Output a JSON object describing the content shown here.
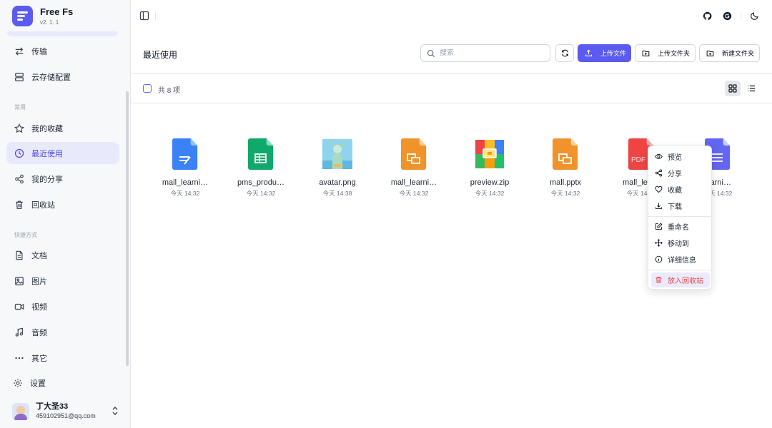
{
  "brand": {
    "name": "Free Fs",
    "version": "v2. 1. 1"
  },
  "sidebar": {
    "top_items": [
      {
        "label": "传输",
        "icon": "transfer-icon"
      },
      {
        "label": "云存储配置",
        "icon": "storage-icon"
      }
    ],
    "common_label": "常用",
    "common_items": [
      {
        "label": "我的收藏",
        "icon": "star-icon"
      },
      {
        "label": "最近使用",
        "icon": "clock-icon",
        "active": true
      },
      {
        "label": "我的分享",
        "icon": "share-icon"
      },
      {
        "label": "回收站",
        "icon": "trash-icon"
      }
    ],
    "shortcut_label": "快捷方式",
    "shortcut_items": [
      {
        "label": "文档",
        "icon": "document-icon"
      },
      {
        "label": "图片",
        "icon": "image-icon"
      },
      {
        "label": "视频",
        "icon": "video-icon"
      },
      {
        "label": "音频",
        "icon": "music-icon"
      },
      {
        "label": "其它",
        "icon": "more-icon"
      }
    ],
    "settings_label": "设置",
    "user": {
      "name": "丁大圣33",
      "email": "459102951@qq.com"
    }
  },
  "header": {
    "title": "最近使用",
    "search_placeholder": "搜索",
    "upload_file": "上传文件",
    "upload_folder": "上传文件夹",
    "new_folder": "新建文件夹"
  },
  "toolbar": {
    "count": "共 8 项"
  },
  "files": [
    {
      "name": "mall_learni…",
      "time": "今天 14:32",
      "type": "doc"
    },
    {
      "name": "pms_produ…",
      "time": "今天 14:32",
      "type": "sheet"
    },
    {
      "name": "avatar.png",
      "time": "今天 14:38",
      "type": "image"
    },
    {
      "name": "mall_learni…",
      "time": "今天 14:32",
      "type": "ppt"
    },
    {
      "name": "preview.zip",
      "time": "今天 14:32",
      "type": "zip"
    },
    {
      "name": "mall.pptx",
      "time": "今天 14:32",
      "type": "ppt"
    },
    {
      "name": "mall_lea…",
      "time": "今天 14:32",
      "type": "pdf",
      "badge": "PDF"
    },
    {
      "name": "learni…",
      "time": "今天 14:32",
      "type": "text"
    }
  ],
  "context_menu": [
    {
      "label": "预览",
      "icon": "eye-icon"
    },
    {
      "label": "分享",
      "icon": "share-icon"
    },
    {
      "label": "收藏",
      "icon": "heart-icon"
    },
    {
      "label": "下载",
      "icon": "download-icon"
    },
    {
      "label": "重命名",
      "icon": "edit-icon"
    },
    {
      "label": "移动到",
      "icon": "move-icon"
    },
    {
      "label": "详细信息",
      "icon": "info-icon"
    },
    {
      "label": "放入回收站",
      "icon": "trash-icon"
    }
  ],
  "colors": {
    "accent": "#5b5bf0",
    "active_bg": "#e8e9fb",
    "danger": "#ef4444"
  }
}
